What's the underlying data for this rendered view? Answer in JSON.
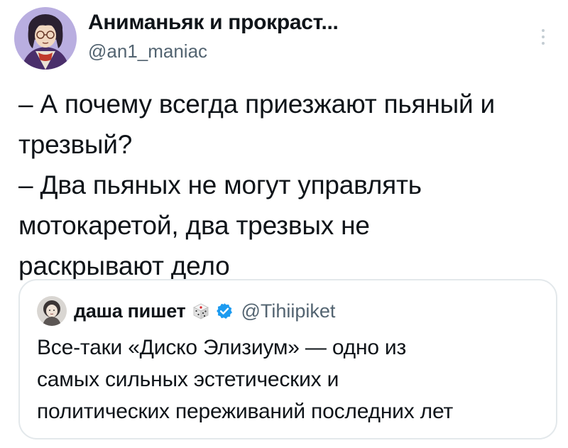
{
  "author": {
    "display_name": "Аниманьяк и прокраст...",
    "handle": "@an1_maniac",
    "avatar_icon": "avatar-illustration"
  },
  "tweet": {
    "lines": [
      "– А почему всегда приезжают пьяный и",
      "трезвый?",
      "– Два пьяных не могут управлять",
      "мотокаретой, два трезвых не",
      "раскрывают дело"
    ]
  },
  "quoted_tweet": {
    "display_name": "даша пишет",
    "handle": "@Tihiipiket",
    "verified_color": "#1d9bf0",
    "lines": [
      "Все-таки «Диско Элизиум» — одно из",
      "самых сильных эстетических и",
      "политических переживаний последних лет"
    ]
  },
  "colors": {
    "text": "#0f1419",
    "secondary": "#536471",
    "border": "#e3e8eb",
    "accent": "#1d9bf0"
  }
}
